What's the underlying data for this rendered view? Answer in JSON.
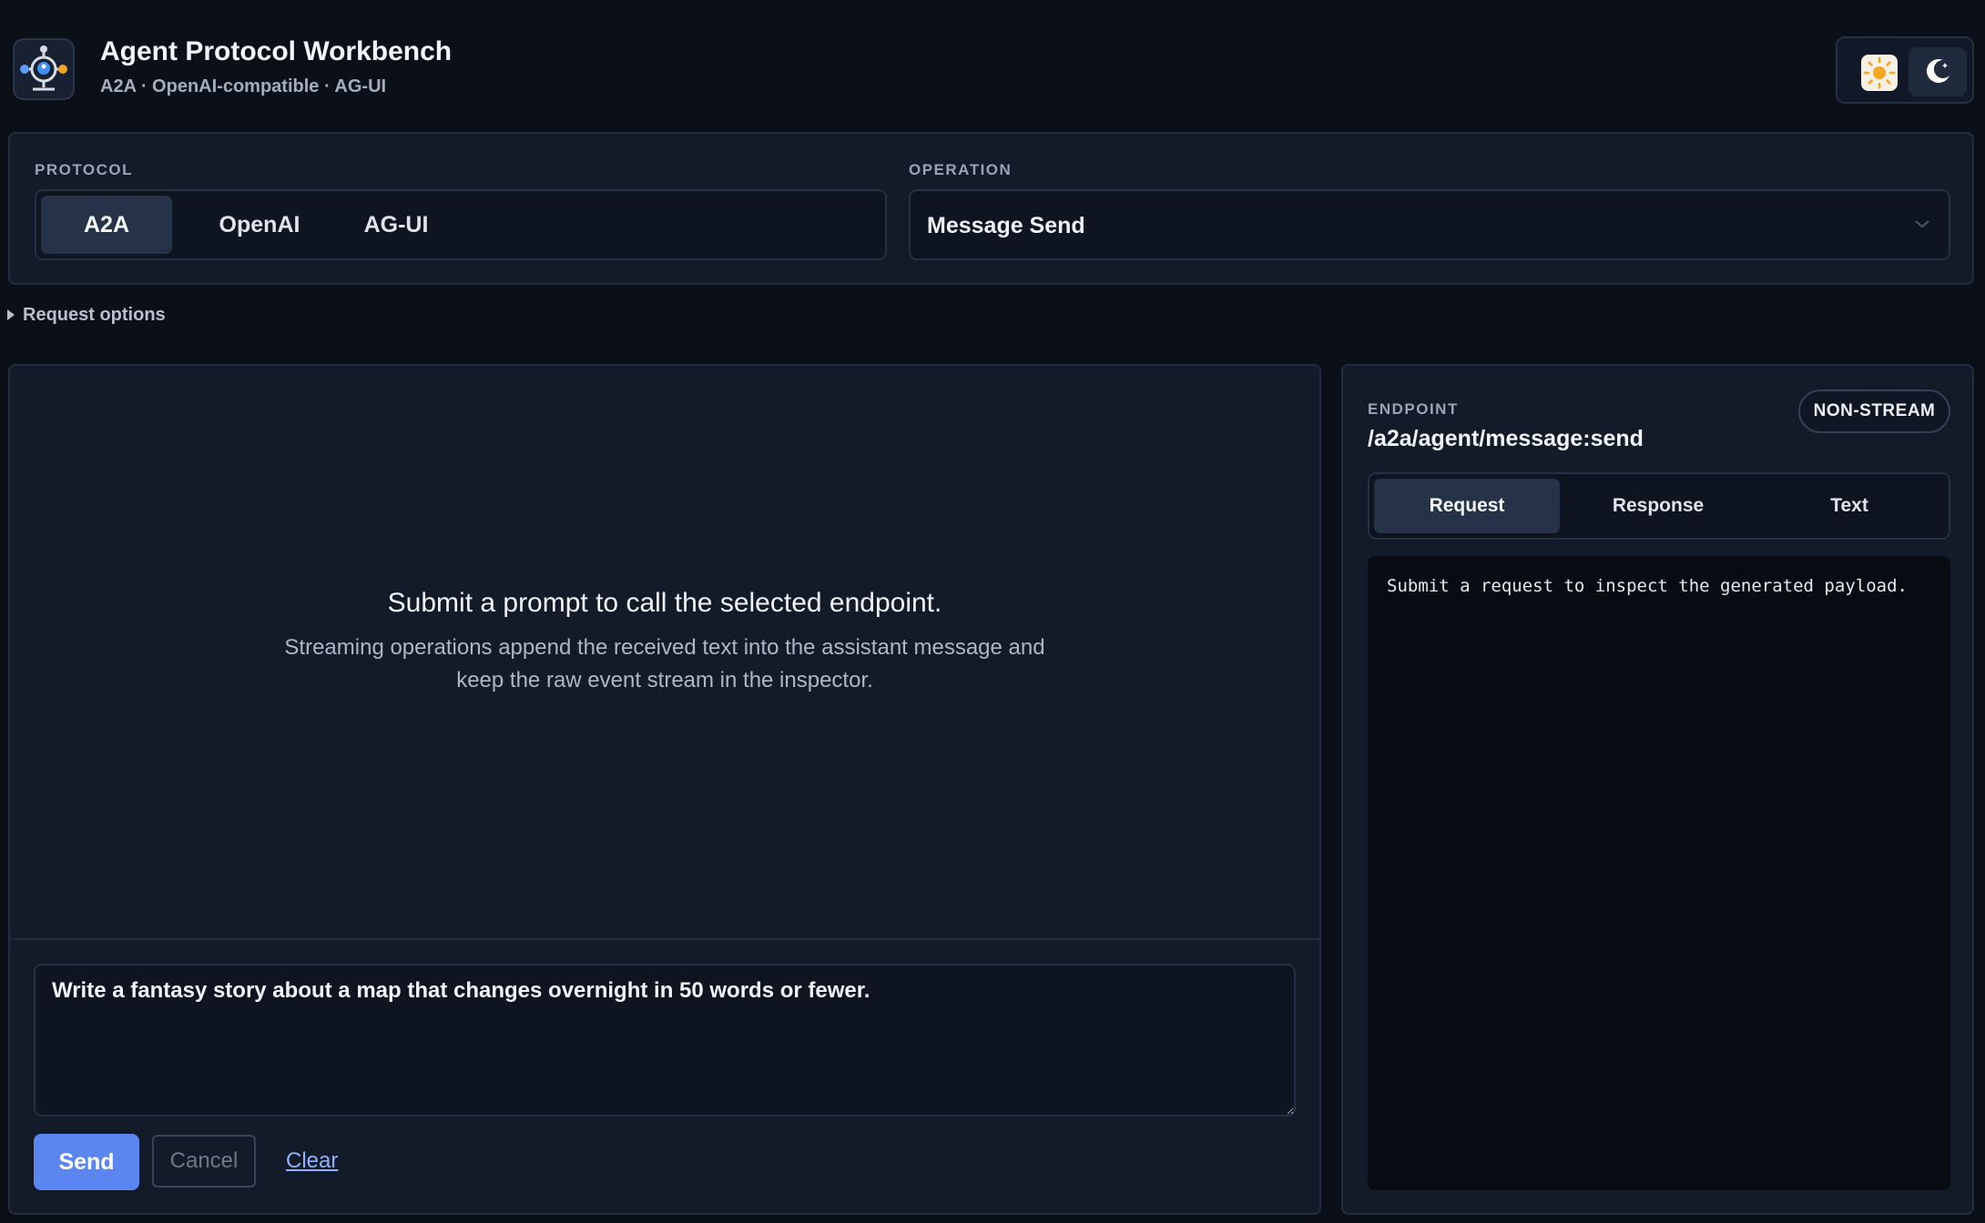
{
  "header": {
    "title": "Agent Protocol Workbench",
    "subtitle": "A2A · OpenAI-compatible · AG-UI",
    "logo_icon": "agent-network-icon",
    "theme_toggle": {
      "light_icon": "sun-icon",
      "dark_icon": "moon-icon",
      "active": "dark"
    }
  },
  "controls": {
    "protocol_label": "PROTOCOL",
    "protocols": [
      "A2A",
      "OpenAI",
      "AG-UI"
    ],
    "selected_protocol": "A2A",
    "operation_label": "OPERATION",
    "operation_value": "Message Send",
    "operation_icon": "chevron-down-icon"
  },
  "request_options": {
    "label": "Request options",
    "expanded": false
  },
  "chat": {
    "empty_title": "Submit a prompt to call the selected endpoint.",
    "empty_body": "Streaming operations append the received text into the assistant message and keep the raw event stream in the inspector.",
    "prompt_value": "Write a fantasy story about a map that changes overnight in 50 words or fewer.",
    "send_label": "Send",
    "cancel_label": "Cancel",
    "clear_label": "Clear"
  },
  "inspector": {
    "endpoint_label": "ENDPOINT",
    "endpoint_path": "/a2a/agent/message:send",
    "mode_badge": "NON-STREAM",
    "tabs": [
      "Request",
      "Response",
      "Text"
    ],
    "active_tab": "Request",
    "payload_text": "Submit a request to inspect the generated payload."
  },
  "colors": {
    "background": "#0b0f18",
    "panel": "#131b28",
    "accent": "#5b86f0",
    "link": "#8fb2ff",
    "sun": "#f5a524"
  }
}
